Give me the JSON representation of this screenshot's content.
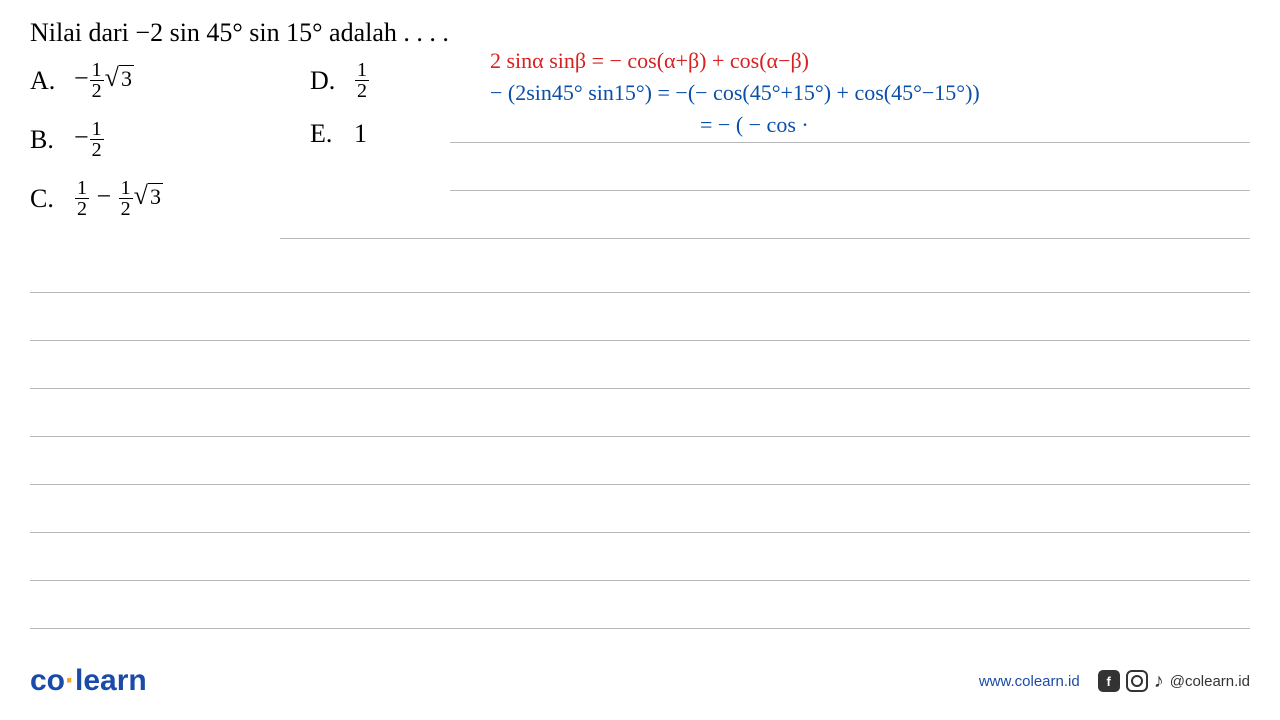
{
  "question": "Nilai dari −2 sin 45° sin 15° adalah . . . .",
  "options": {
    "A": {
      "letter": "A.",
      "neg": "−",
      "num": "1",
      "den": "2",
      "rad": "3"
    },
    "B": {
      "letter": "B.",
      "neg": "−",
      "num": "1",
      "den": "2"
    },
    "C": {
      "letter": "C.",
      "num1": "1",
      "den1": "2",
      "mid": " − ",
      "num2": "1",
      "den2": "2",
      "rad": "3"
    },
    "D": {
      "letter": "D.",
      "num": "1",
      "den": "2"
    },
    "E": {
      "letter": "E.",
      "val": "1"
    }
  },
  "handwriting": {
    "line1": "2 sinα sinβ = − cos(α+β) + cos(α−β)",
    "line2": "− (2sin45° sin15°) = −(− cos(45°+15°) + cos(45°−15°))",
    "line3": "= − ( − cos  ·"
  },
  "footer": {
    "logo_co": "co",
    "logo_dot": "·",
    "logo_learn": "learn",
    "url": "www.colearn.id",
    "handle": "@colearn.id"
  }
}
